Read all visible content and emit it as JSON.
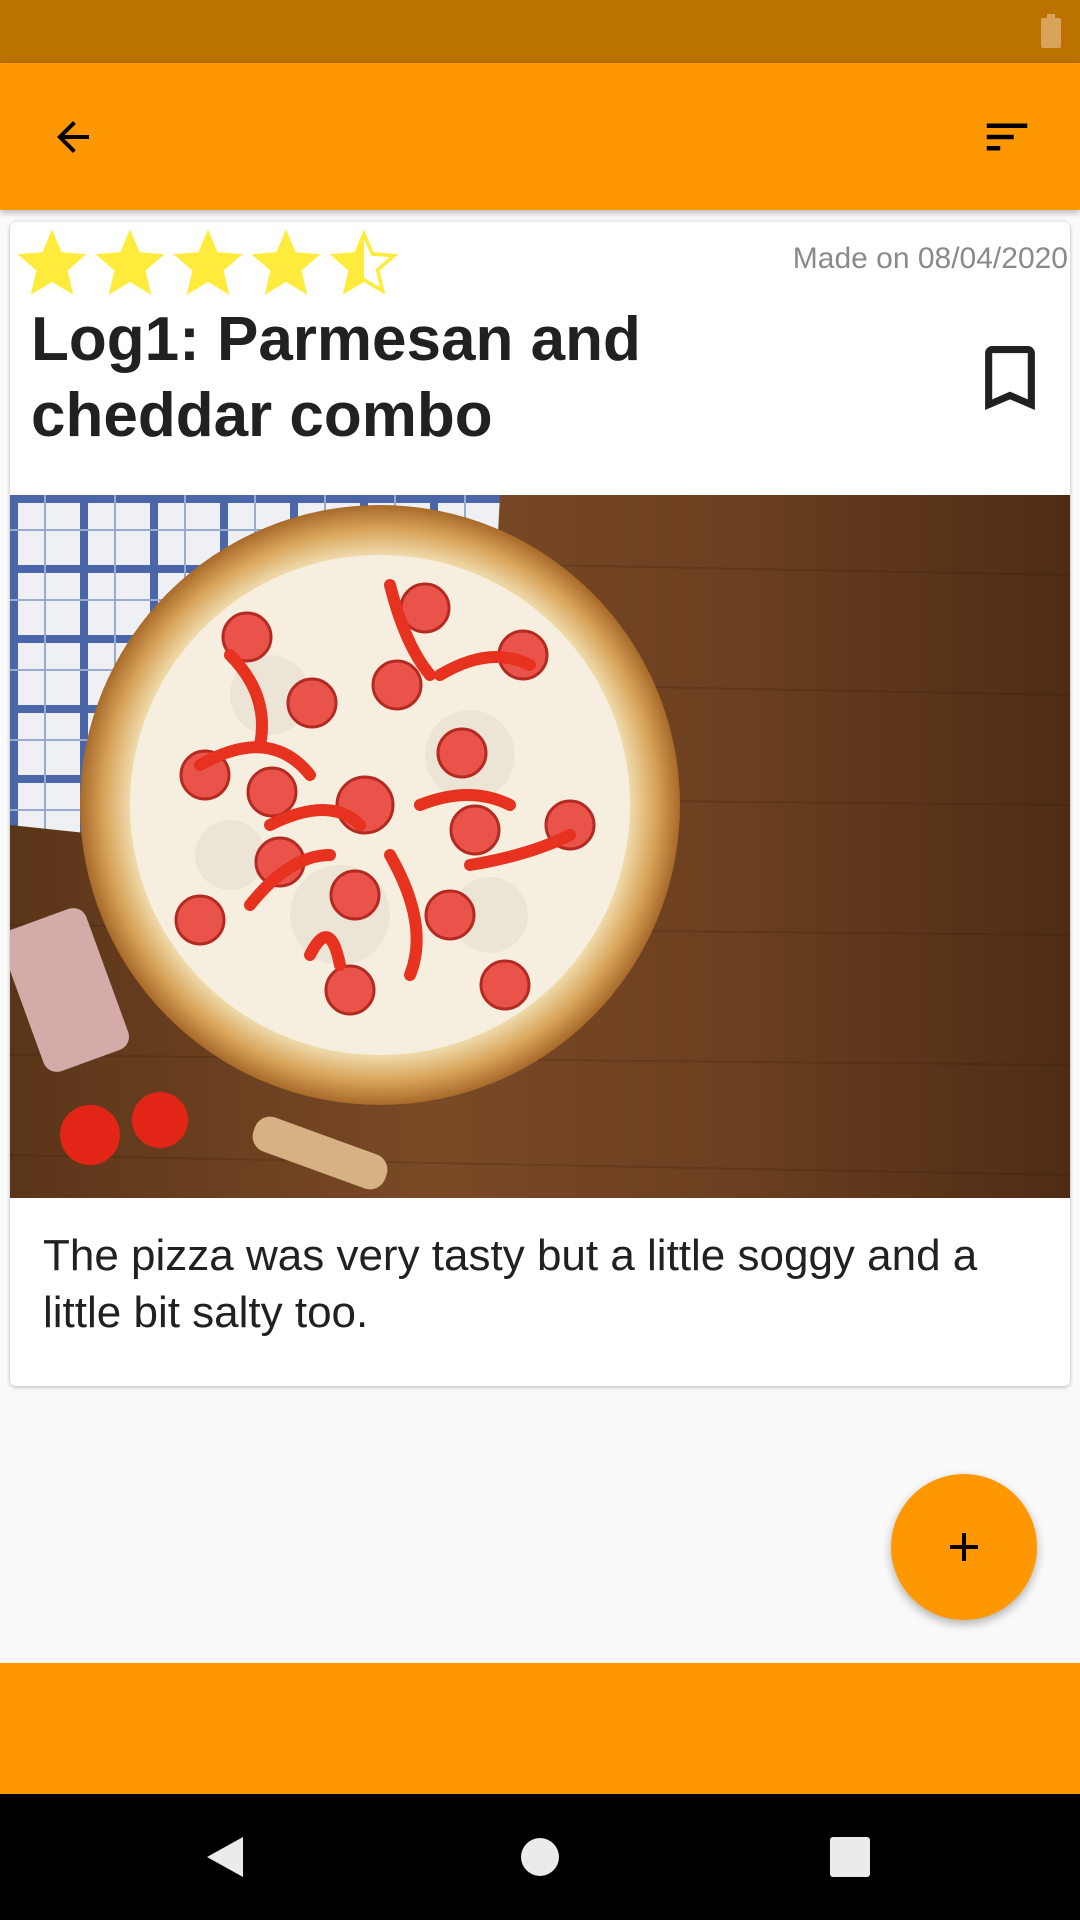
{
  "colors": {
    "status_bar": "#bb7200",
    "accent": "#ff9800",
    "star": "#ffeb3b",
    "text_primary": "#212121",
    "text_secondary": "#8a8a8a"
  },
  "app_bar": {
    "back_icon": "arrow-back-icon",
    "sort_icon": "sort-icon"
  },
  "log": {
    "rating": 4.5,
    "rating_max": 5,
    "made_on": "Made on 08/04/2020",
    "title": "Log1: Parmesan and cheddar combo",
    "image_alt": "pizza-photo",
    "description": "The pizza was very tasty but a little soggy and a little bit salty too."
  },
  "fab": {
    "icon": "add-icon"
  },
  "nav": {
    "back_icon": "nav-back-icon",
    "home_icon": "nav-home-icon",
    "recents_icon": "nav-recents-icon"
  }
}
